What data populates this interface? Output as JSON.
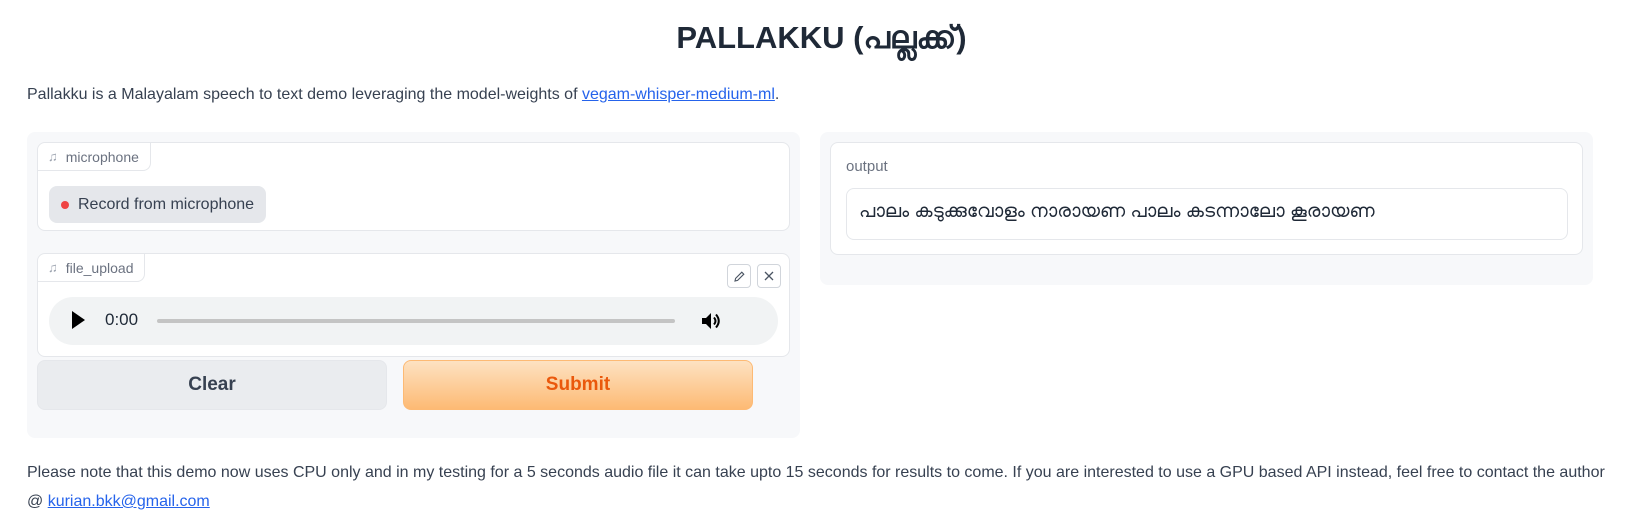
{
  "app": {
    "title": "PALLAKKU (പല്ലക്ക്)",
    "intro_text": "Pallakku is a Malayalam speech to text demo leveraging the model-weights of ",
    "intro_link": "vegam-whisper-medium-ml",
    "intro_suffix": "."
  },
  "inputs": {
    "microphone": {
      "label": "microphone",
      "record_label": "Record from microphone"
    },
    "file_upload": {
      "label": "file_upload",
      "time": "0:00",
      "progress": 0
    }
  },
  "actions": {
    "clear_label": "Clear",
    "submit_label": "Submit"
  },
  "output": {
    "label": "output",
    "value": "പാലം കടുക്കുവോളം നാരായണ പാലം കടന്നാലോ കൂരായണ"
  },
  "footer": {
    "text": "Please note that this demo now uses CPU only and in my testing for a 5 seconds audio file it can take upto 15 seconds for results to come. If you are interested to use a GPU based API instead, feel free to contact the author @ ",
    "email": "kurian.bkk@gmail.com"
  },
  "colors": {
    "accent": "#ea580c",
    "link": "#2563eb",
    "record_dot": "#ef4444"
  },
  "icons": {
    "component_icon": "music-note-icon",
    "edit": "pencil-icon",
    "close": "close-icon",
    "play": "play-icon",
    "volume": "volume-icon"
  }
}
